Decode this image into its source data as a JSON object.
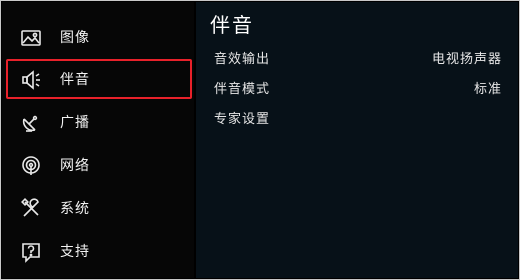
{
  "sidebar": {
    "items": [
      {
        "label": "图像",
        "icon": "picture-icon"
      },
      {
        "label": "伴音",
        "icon": "speaker-icon",
        "selected": true
      },
      {
        "label": "广播",
        "icon": "satellite-dish-icon"
      },
      {
        "label": "网络",
        "icon": "network-icon"
      },
      {
        "label": "系统",
        "icon": "tools-icon"
      },
      {
        "label": "支持",
        "icon": "help-icon"
      }
    ]
  },
  "main": {
    "title": "伴音",
    "settings": [
      {
        "label": "音效输出",
        "value": "电视扬声器"
      },
      {
        "label": "伴音模式",
        "value": "标准"
      },
      {
        "label": "专家设置",
        "value": ""
      }
    ]
  },
  "colors": {
    "selection_border": "#e8212a",
    "sidebar_bg": "#060606",
    "content_bg": "#071118",
    "text": "#f2f2f2"
  }
}
